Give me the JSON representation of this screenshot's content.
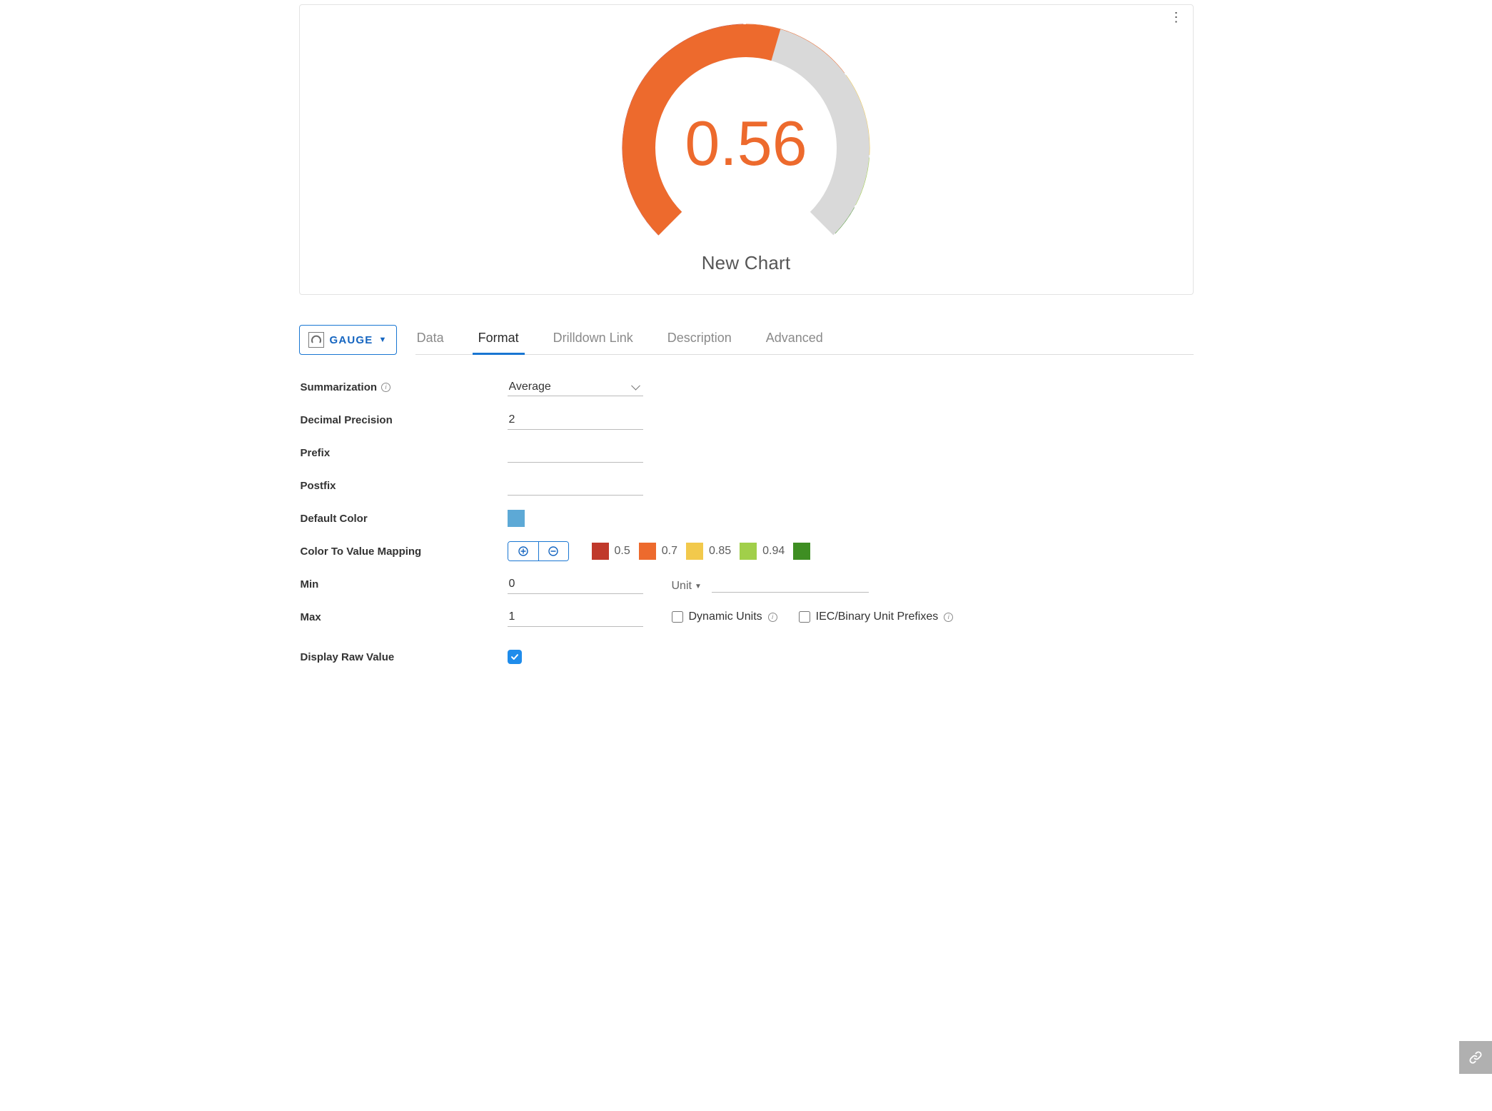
{
  "chart": {
    "title": "New Chart",
    "value_display": "0.56",
    "value_color": "#ED6A2D"
  },
  "chart_data": {
    "type": "gauge",
    "value": 0.56,
    "min": 0,
    "max": 1,
    "decimal_precision": 2,
    "summarization": "Average",
    "title": "New Chart",
    "start_angle_deg": -225,
    "end_angle_deg": 45,
    "color_stops": [
      {
        "upto": 0.5,
        "color": "#C0392B"
      },
      {
        "upto": 0.7,
        "color": "#ED6A2D"
      },
      {
        "upto": 0.85,
        "color": "#F2C94C"
      },
      {
        "upto": 0.94,
        "color": "#A1CF4A"
      },
      {
        "upto": 1.0,
        "color": "#3E8E22"
      }
    ]
  },
  "chart_type_button": {
    "label": "GAUGE"
  },
  "tabs": [
    {
      "label": "Data",
      "active": false
    },
    {
      "label": "Format",
      "active": true
    },
    {
      "label": "Drilldown Link",
      "active": false
    },
    {
      "label": "Description",
      "active": false
    },
    {
      "label": "Advanced",
      "active": false
    }
  ],
  "form": {
    "summarization_label": "Summarization",
    "summarization_value": "Average",
    "decimal_precision_label": "Decimal Precision",
    "decimal_precision_value": "2",
    "prefix_label": "Prefix",
    "prefix_value": "",
    "postfix_label": "Postfix",
    "postfix_value": "",
    "default_color_label": "Default Color",
    "default_color_value": "#5DA9D6",
    "ctv_label": "Color To Value Mapping",
    "ctv_stops": [
      {
        "color": "#C0392B",
        "value": "0.5"
      },
      {
        "color": "#ED6A2D",
        "value": "0.7"
      },
      {
        "color": "#F2C94C",
        "value": "0.85"
      },
      {
        "color": "#A1CF4A",
        "value": "0.94"
      },
      {
        "color": "#3E8E22",
        "value": ""
      }
    ],
    "min_label": "Min",
    "min_value": "0",
    "max_label": "Max",
    "max_value": "1",
    "unit_label": "Unit",
    "dynamic_units_label": "Dynamic Units",
    "iec_prefixes_label": "IEC/Binary Unit Prefixes",
    "display_raw_label": "Display Raw Value",
    "display_raw_checked": true
  }
}
